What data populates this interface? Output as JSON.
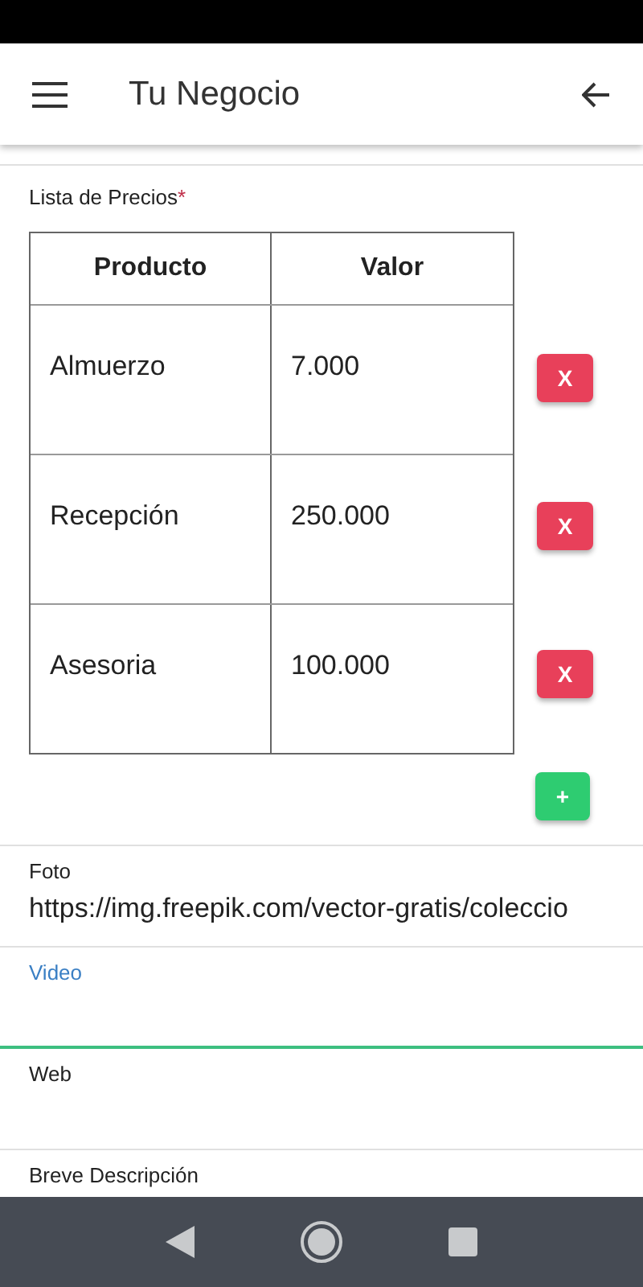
{
  "app_bar": {
    "title": "Tu Negocio"
  },
  "price_list": {
    "label": "Lista de Precios",
    "required_mark": "*",
    "columns": [
      "Producto",
      "Valor"
    ],
    "rows": [
      {
        "product": "Almuerzo",
        "value": "7.000",
        "delete_label": "X"
      },
      {
        "product": "Recepción",
        "value": "250.000",
        "delete_label": "X"
      },
      {
        "product": "Asesoria",
        "value": "100.000",
        "delete_label": "X"
      }
    ],
    "add_label": "+"
  },
  "fields": [
    {
      "label": "Foto",
      "value": "https://img.freepik.com/vector-gratis/coleccio",
      "focused": false
    },
    {
      "label": "Video",
      "focused": true
    },
    {
      "label": "Web",
      "focused": false
    },
    {
      "label": "Breve Descripción",
      "focused": false
    }
  ]
}
